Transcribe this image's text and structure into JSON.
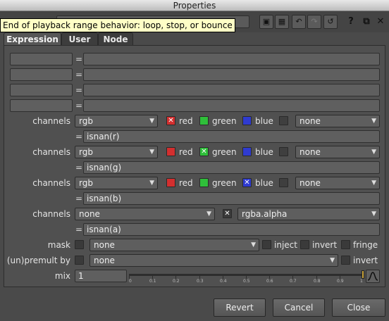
{
  "window": {
    "title": "Properties"
  },
  "toolbar": {
    "tooltip": "End of playback range behavior: loop, stop, or bounce",
    "help_label": "?"
  },
  "tabs": [
    "Expression",
    "User",
    "Node"
  ],
  "expression_rows": [
    {
      "name": "",
      "expr": ""
    },
    {
      "name": "",
      "expr": ""
    },
    {
      "name": "",
      "expr": ""
    },
    {
      "name": "",
      "expr": ""
    }
  ],
  "channel_groups": [
    {
      "label": "channels",
      "layer": "rgb",
      "red": true,
      "green": false,
      "blue": false,
      "red_label": "red",
      "green_label": "green",
      "blue_label": "blue",
      "extra": "none",
      "expr": "isnan(r)"
    },
    {
      "label": "channels",
      "layer": "rgb",
      "red": false,
      "green": true,
      "blue": false,
      "red_label": "red",
      "green_label": "green",
      "blue_label": "blue",
      "extra": "none",
      "expr": "isnan(g)"
    },
    {
      "label": "channels",
      "layer": "rgb",
      "red": false,
      "green": false,
      "blue": true,
      "red_label": "red",
      "green_label": "green",
      "blue_label": "blue",
      "extra": "none",
      "expr": "isnan(b)"
    }
  ],
  "alpha_group": {
    "label": "channels",
    "layer": "none",
    "channel": "rgba.alpha",
    "expr": "isnan(a)"
  },
  "mask": {
    "label": "mask",
    "value": "none",
    "inject_label": "inject",
    "invert_label": "invert",
    "fringe_label": "fringe"
  },
  "premult": {
    "label": "(un)premult by",
    "value": "none",
    "invert_label": "invert"
  },
  "mix": {
    "label": "mix",
    "value": "1",
    "level": 1.0,
    "ticks": [
      "0",
      "0.1",
      "0.2",
      "0.3",
      "0.4",
      "0.5",
      "0.6",
      "0.7",
      "0.8",
      "0.9",
      "1"
    ]
  },
  "buttons": {
    "revert": "Revert",
    "cancel": "Cancel",
    "close": "Close"
  },
  "colors": {
    "red": "#d32f2f",
    "green": "#2fbf3a",
    "blue": "#2f3bd0",
    "tooltip_bg": "#ffffc6"
  }
}
